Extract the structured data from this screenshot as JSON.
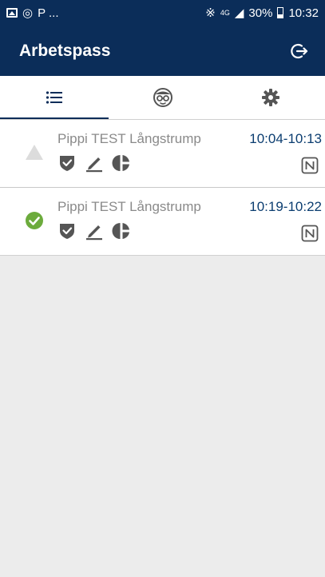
{
  "status_bar": {
    "left_text": "P ...",
    "network": "4G",
    "battery": "30%",
    "time": "10:32"
  },
  "app_bar": {
    "title": "Arbetspass",
    "action_icon": "logout-icon"
  },
  "tabs": [
    {
      "icon": "list-icon",
      "active": true
    },
    {
      "icon": "person-glasses-icon",
      "active": false
    },
    {
      "icon": "gear-icon",
      "active": false
    }
  ],
  "shifts": [
    {
      "name": "Pippi TEST Långstrump",
      "time": "10:04-10:13",
      "status": "warning",
      "status_icon": "warning-triangle-icon"
    },
    {
      "name": "Pippi TEST Långstrump",
      "time": "10:19-10:22",
      "status": "completed",
      "status_icon": "check-circle-icon"
    }
  ],
  "colors": {
    "primary": "#0b2d59",
    "time_text": "#0b3d70",
    "check_green": "#6cab3c",
    "warning_grey": "#dcdcdc",
    "icon_grey": "#555555"
  }
}
